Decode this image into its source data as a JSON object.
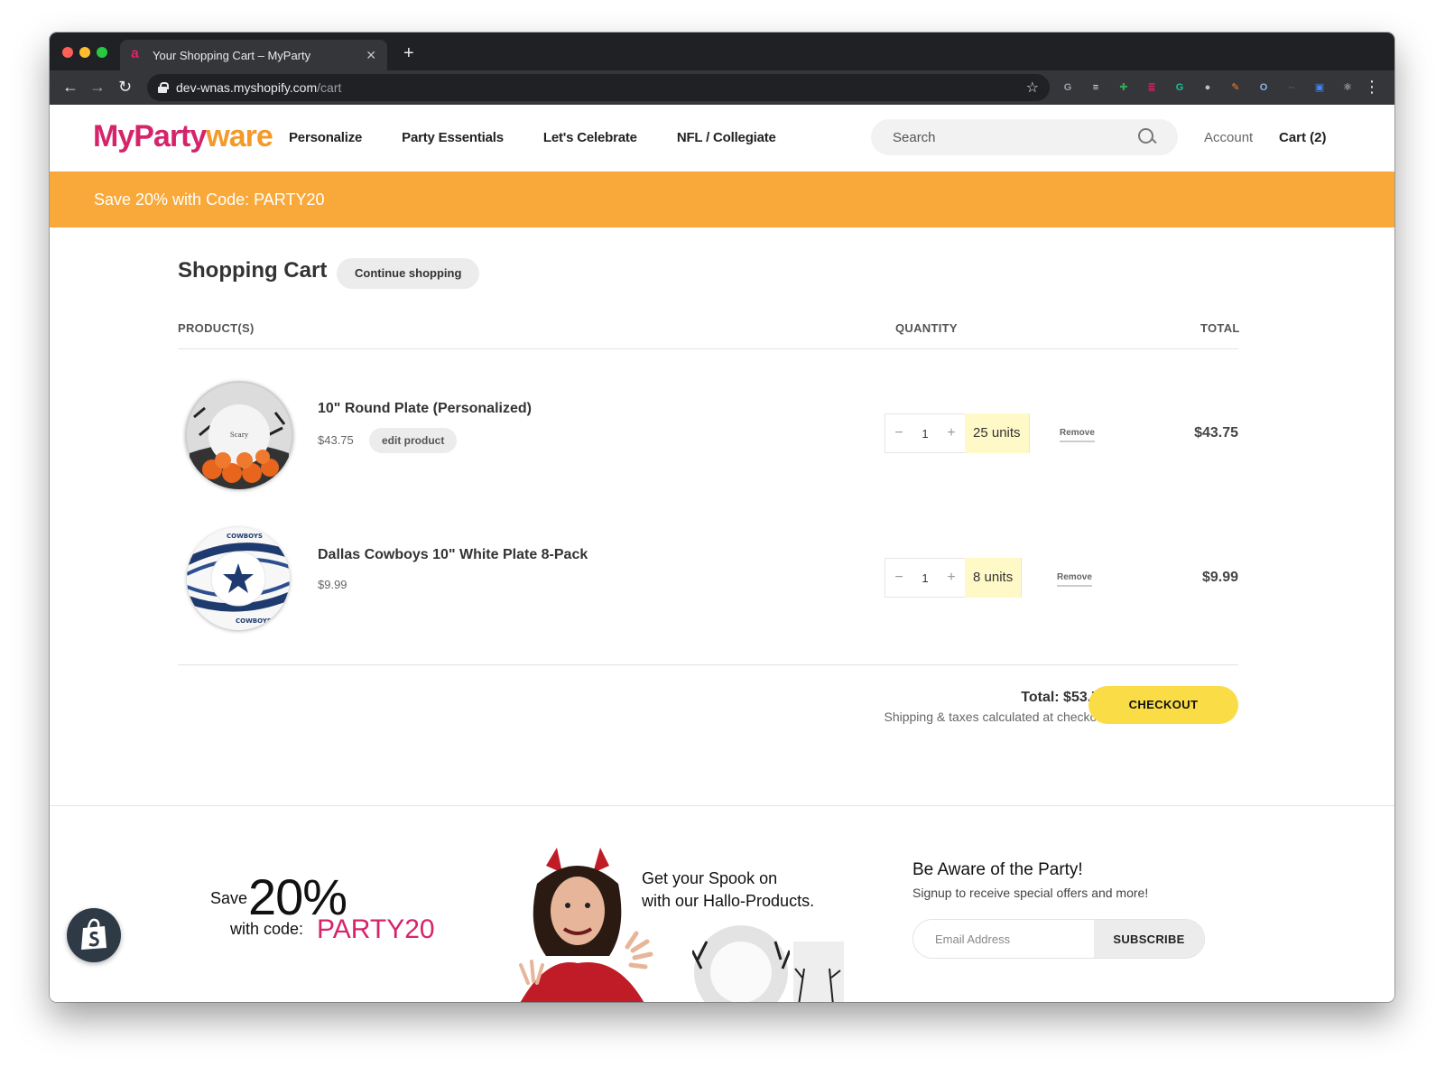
{
  "browser": {
    "tab_title": "Your Shopping Cart – MyParty",
    "new_tab_label": "+",
    "url_host": "dev-wnas.myshopify.com",
    "url_path": "/cart",
    "extensions": [
      {
        "name": "g-ext-icon",
        "glyph": "G",
        "color": "#9aa0a6"
      },
      {
        "name": "reader-ext-icon",
        "glyph": "≡",
        "color": "#e8eaed"
      },
      {
        "name": "shield-ext-icon",
        "glyph": "✚",
        "color": "#34a853"
      },
      {
        "name": "notes-ext-icon",
        "glyph": "≣",
        "color": "#e91e63"
      },
      {
        "name": "grammarly-icon",
        "glyph": "G",
        "color": "#15c39a"
      },
      {
        "name": "circle-ext-icon",
        "glyph": "●",
        "color": "#bdc1c6"
      },
      {
        "name": "edit-ext-icon",
        "glyph": "✎",
        "color": "#f48024"
      },
      {
        "name": "o-ext-icon",
        "glyph": "O",
        "color": "#8ab4f8"
      },
      {
        "name": "link-ext-icon",
        "glyph": "⇔",
        "color": "#5f6368"
      },
      {
        "name": "window-ext-icon",
        "glyph": "▣",
        "color": "#4285f4"
      },
      {
        "name": "react-ext-icon",
        "glyph": "⚛",
        "color": "#e8eaed"
      }
    ]
  },
  "site": {
    "logo_my": "MyParty",
    "logo_ware": "ware",
    "nav": [
      "Personalize",
      "Party Essentials",
      "Let's Celebrate",
      "NFL / Collegiate"
    ],
    "search_placeholder": "Search",
    "account_label": "Account",
    "cart_label": "Cart (2)",
    "promo_text": "Save 20% with Code: PARTY20"
  },
  "cart": {
    "title": "Shopping Cart",
    "continue_label": "Continue shopping",
    "headers": {
      "products": "PRODUCT(S)",
      "quantity": "QUANTITY",
      "total": "TOTAL"
    },
    "items": [
      {
        "name": "10\" Round Plate (Personalized)",
        "price": "$43.75",
        "edit_label": "edit product",
        "qty": "1",
        "units": "25 units",
        "remove_label": "Remove",
        "line_total": "$43.75",
        "thumb_text": "Scary"
      },
      {
        "name": "Dallas Cowboys 10\" White Plate 8-Pack",
        "price": "$9.99",
        "qty": "1",
        "units": "8 units",
        "remove_label": "Remove",
        "line_total": "$9.99",
        "thumb_text_top": "COWBOYS",
        "thumb_text_bottom": "COWBOYS"
      }
    ],
    "total_line": "Total: $53.74",
    "shipping_note": "Shipping & taxes calculated at checkout",
    "checkout_label": "CHECKOUT"
  },
  "footer": {
    "save_word": "Save",
    "save_pct": "20%",
    "with_code": "with code:",
    "code": "PARTY20",
    "spook_line1": "Get your Spook on",
    "spook_line2": "with our Hallo-Products.",
    "aware_title": "Be Aware of the Party!",
    "aware_sub": "Signup to receive special offers and more!",
    "email_placeholder": "Email Address",
    "subscribe_label": "SUBSCRIBE"
  }
}
